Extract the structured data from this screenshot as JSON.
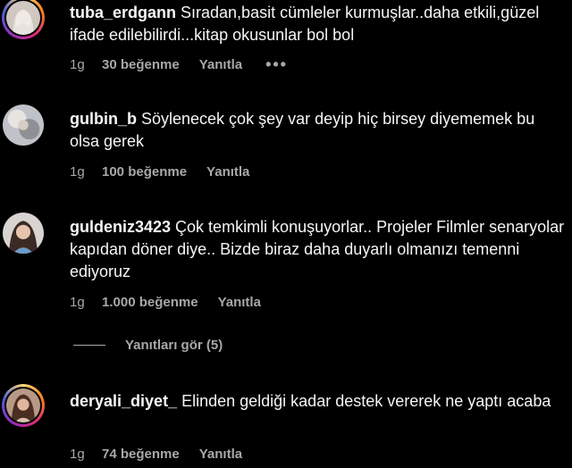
{
  "comments": [
    {
      "username": "tuba_erdgann",
      "text": "Sıradan,basit cümleler kurmuşlar..daha etkili,güzel ifade edilebilirdi...kitap okusunlar bol bol",
      "age": "1g",
      "likes": "30 beğenme",
      "reply": "Yanıtla",
      "more": "•••",
      "avatar_icon": "profile-avatar-icon"
    },
    {
      "username": "gulbin_b",
      "text": "Söylenecek çok şey var deyip hiç birsey diyememek bu olsa gerek",
      "age": "1g",
      "likes": "100 beğenme",
      "reply": "Yanıtla",
      "avatar_icon": "profile-avatar-icon"
    },
    {
      "username": "guldeniz3423",
      "text": "Çok temkimli konuşuyorlar.. Projeler Filmler senaryolar kapıdan döner diye.. Bizde biraz daha duyarlı olmanızı temenni ediyoruz",
      "age": "1g",
      "likes": "1.000 beğenme",
      "reply": "Yanıtla",
      "avatar_icon": "profile-avatar-icon"
    },
    {
      "username": "deryali_diyet_",
      "text": "Elinden geldiği kadar destek vererek ne yaptı acaba",
      "age": "1g",
      "likes": "74 beğenme",
      "reply": "Yanıtla",
      "avatar_icon": "profile-avatar-icon"
    }
  ],
  "view_replies": "Yanıtları gör (5)",
  "colors": {
    "background": "#000000",
    "text": "#f5f5f5",
    "secondary": "#a8a8a8"
  }
}
